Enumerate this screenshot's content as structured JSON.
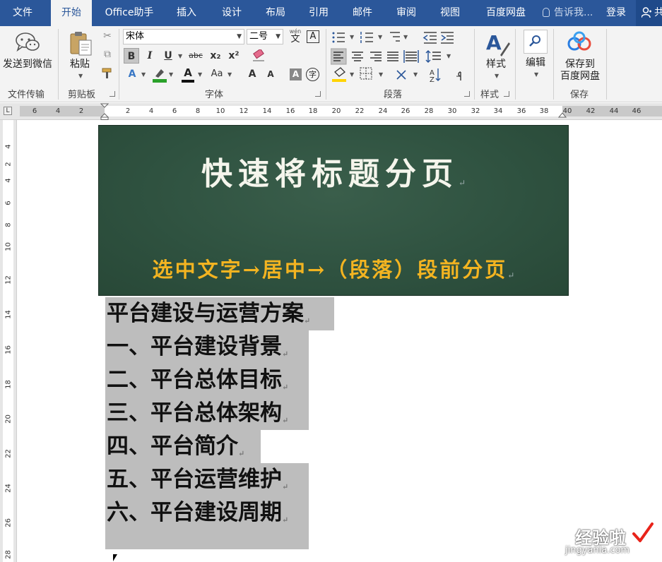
{
  "menu_tabs": [
    "文件",
    "开始",
    "Office助手",
    "插入",
    "设计",
    "布局",
    "引用",
    "邮件",
    "审阅",
    "视图",
    "百度网盘"
  ],
  "tell_me": "告诉我...",
  "login": "登录",
  "share_label": "共",
  "colors": {
    "accent": "#2b579a",
    "banner_bg": "#2f5240",
    "banner_sub": "#f3b421",
    "selection": "#bdbdbd"
  },
  "ribbon": {
    "wechat": {
      "label": "发送到微信",
      "group": "文件传输",
      "icon": "wechat-icon"
    },
    "clipboard": {
      "paste_label": "粘贴",
      "group": "剪贴板"
    },
    "font": {
      "name": "宋体",
      "size": "二号",
      "group": "字体",
      "row2": [
        "B",
        "I",
        "U",
        "abc",
        "x₂",
        "x²"
      ],
      "row3": [
        "A",
        "A",
        "Aa",
        "A",
        "A"
      ],
      "wen_label": "wén",
      "wen_char": "文",
      "box_char": "A",
      "circle_char": "字"
    },
    "paragraph": {
      "group": "段落"
    },
    "styles": {
      "label": "样式",
      "group": "样式"
    },
    "editing": {
      "label": "编辑"
    },
    "save": {
      "label": "保存到\n百度网盘",
      "group": "保存"
    }
  },
  "ruler": {
    "h_marks": [
      "6",
      "4",
      "2",
      "2",
      "4",
      "6",
      "8",
      "10",
      "12",
      "14",
      "16",
      "18",
      "20",
      "22",
      "24",
      "26",
      "28",
      "30",
      "32",
      "34",
      "36",
      "38",
      "40",
      "42",
      "44",
      "46"
    ],
    "v_marks": [
      "4",
      "2",
      "4",
      "6",
      "8",
      "10",
      "12",
      "14",
      "16",
      "18",
      "20",
      "22",
      "24",
      "26",
      "28"
    ]
  },
  "banner": {
    "title": "快速将标题分页",
    "subtitle": "选中文字→居中→（段落）段前分页"
  },
  "document_lines": [
    "平台建设与运营方案",
    "一、平台建设背景",
    "二、平台总体目标",
    "三、平台总体架构",
    "四、平台简介",
    "五、平台运营维护",
    "六、平台建设周期"
  ],
  "watermark": {
    "text": "经验啦",
    "url": "jingyanla.com"
  }
}
